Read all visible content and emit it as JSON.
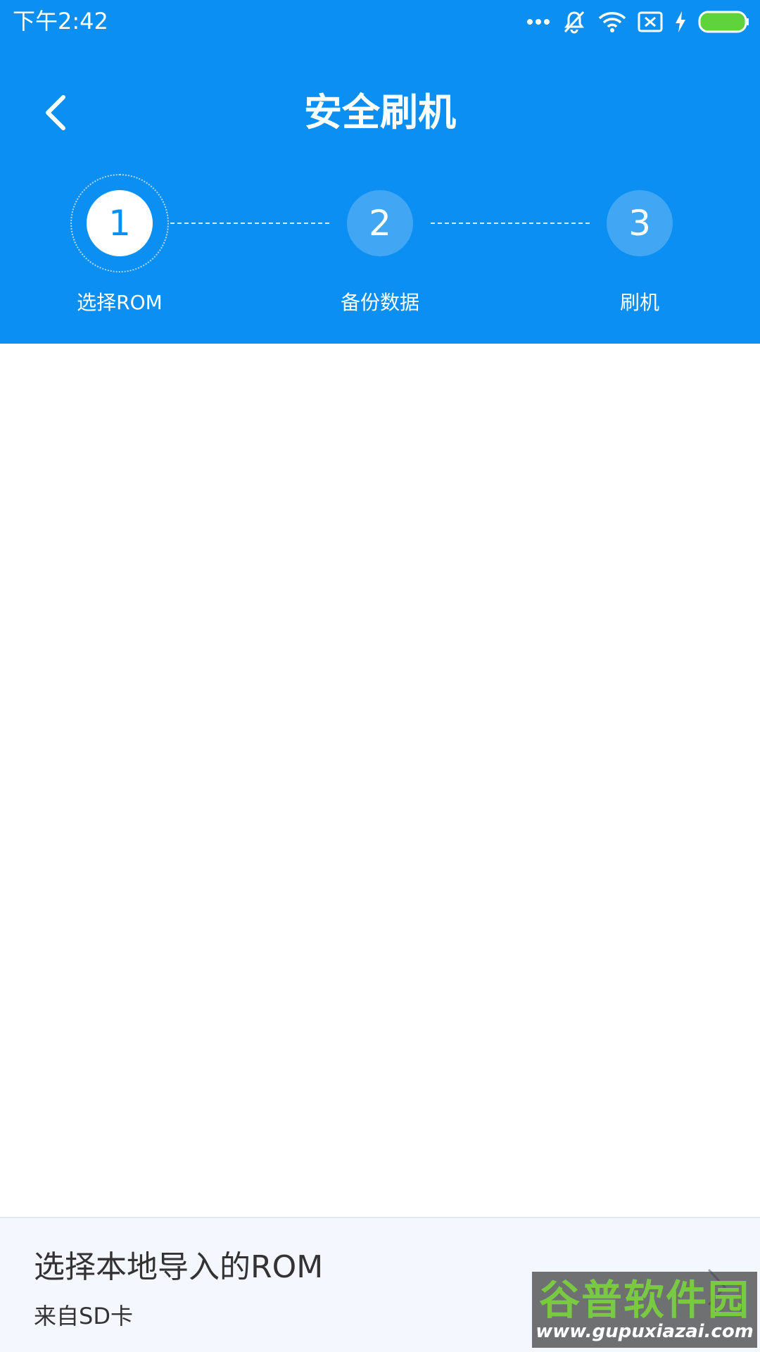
{
  "status_bar": {
    "time": "下午2:42",
    "icons": [
      "more-dots-icon",
      "mute-icon",
      "wifi-icon",
      "sim-none-icon",
      "charging-icon",
      "battery-icon"
    ]
  },
  "nav": {
    "title": "安全刷机",
    "back_icon": "chevron-left-icon"
  },
  "steps": [
    {
      "number": "1",
      "label": "选择ROM",
      "active": true
    },
    {
      "number": "2",
      "label": "备份数据",
      "active": false
    },
    {
      "number": "3",
      "label": "刷机",
      "active": false
    }
  ],
  "import": {
    "title": "选择本地导入的ROM",
    "subtitle": "来自SD卡",
    "icon": "chevron-right-icon"
  },
  "watermark": {
    "text": "谷普软件园",
    "url": "www.gupuxiazai.com"
  },
  "colors": {
    "primary": "#0c8ff2",
    "battery": "#5ed33b",
    "import_bg": "#f4f7fd",
    "text_dark": "#333333"
  }
}
